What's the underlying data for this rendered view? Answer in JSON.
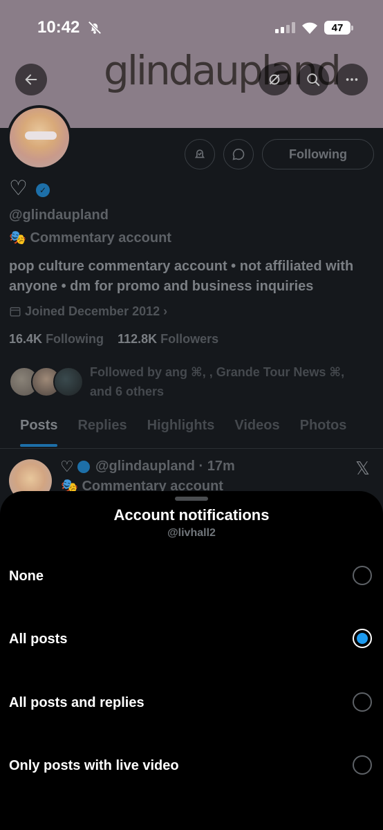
{
  "status_bar": {
    "time": "10:42",
    "battery": "47"
  },
  "banner": {
    "text": "glindaupland"
  },
  "profile": {
    "following_button": "Following",
    "name_emoji": "♡",
    "handle": "@glindaupland",
    "label": "Commentary account",
    "bio": "pop culture commentary account • not affiliated with anyone • dm for promo and business inquiries",
    "joined": "Joined December 2012",
    "following_count": "16.4K",
    "following_label": "Following",
    "followers_count": "112.8K",
    "followers_label": "Followers",
    "followed_by": "Followed by ang ⌘, , Grande Tour News ⌘, and 6 others"
  },
  "tabs": [
    {
      "label": "Posts"
    },
    {
      "label": "Replies"
    },
    {
      "label": "Highlights"
    },
    {
      "label": "Videos"
    },
    {
      "label": "Photos"
    }
  ],
  "post": {
    "heart": "♡",
    "head": "@glindaupland · 17m",
    "sub": "Commentary account",
    "x": "𝕏"
  },
  "sheet": {
    "title": "Account notifications",
    "subtitle": "@livhall2",
    "options": [
      {
        "label": "None",
        "selected": false
      },
      {
        "label": "All posts",
        "selected": true
      },
      {
        "label": "All posts and replies",
        "selected": false
      },
      {
        "label": "Only posts with live video",
        "selected": false
      }
    ]
  },
  "colors": {
    "accent": "#1d9bf0",
    "background": "#000000"
  }
}
